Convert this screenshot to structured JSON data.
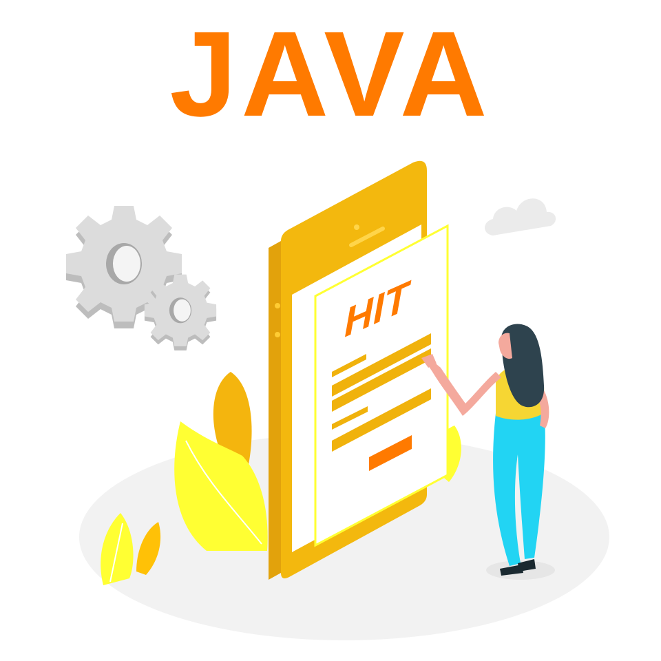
{
  "headline": {
    "text": "JAVA"
  },
  "phone_screen": {
    "brand_text": "HIT"
  },
  "colors": {
    "headline": "#ff7a00",
    "phone_body": "#f3b80e",
    "phone_edge": "#e2a20c",
    "screen": "#ffffff",
    "panel_border": "#ffff33",
    "form_bar": "#f0b20c",
    "submit_button": "#ff7a00",
    "gear": "#d9d9d9",
    "cloud": "#ebebeb",
    "ground": "#f2f2f2",
    "leaf": "#ffff33",
    "woman_pants": "#22d4f3",
    "woman_top": "#f6d633",
    "woman_hair": "#2e434e",
    "woman_skin": "#f4a99d"
  },
  "icons": [
    "gear-icon",
    "cloud-icon",
    "phone-icon",
    "plant-icon"
  ]
}
